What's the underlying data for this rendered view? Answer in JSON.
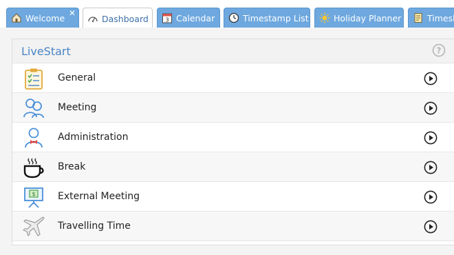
{
  "tabs": [
    {
      "label": "Welcome",
      "icon": "home-icon",
      "closable": true
    },
    {
      "label": "Dashboard",
      "icon": "dashboard-icon",
      "active": true
    },
    {
      "label": "Calendar",
      "icon": "calendar-icon",
      "calendar_day": "3"
    },
    {
      "label": "Timestamp List",
      "icon": "clock-icon"
    },
    {
      "label": "Holiday Planner",
      "icon": "sun-icon"
    },
    {
      "label": "Timesh",
      "icon": "timesheet-icon"
    }
  ],
  "panel": {
    "title": "LiveStart",
    "items": [
      {
        "label": "General",
        "icon": "clipboard-checklist-icon"
      },
      {
        "label": "Meeting",
        "icon": "people-meeting-icon"
      },
      {
        "label": "Administration",
        "icon": "administrator-person-icon"
      },
      {
        "label": "Break",
        "icon": "coffee-cup-icon"
      },
      {
        "label": "External Meeting",
        "icon": "presentation-board-icon"
      },
      {
        "label": "Travelling Time",
        "icon": "airplane-icon"
      }
    ]
  },
  "colors": {
    "tab_bg": "#6ea8df",
    "title": "#4a86c5",
    "play": "#222222"
  }
}
